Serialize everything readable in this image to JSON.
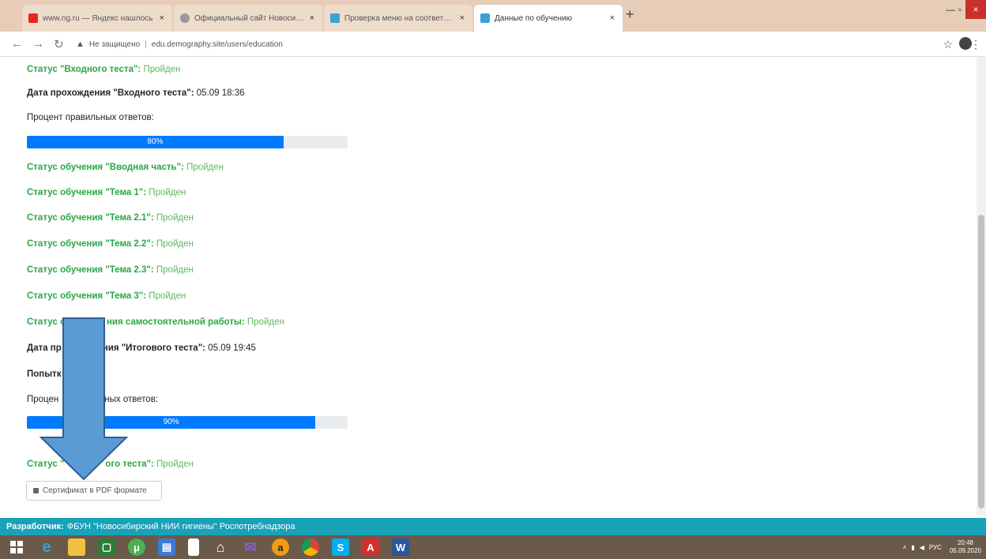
{
  "browser": {
    "tabs": [
      {
        "label": "www.ng.ru — Яндекс нашлось",
        "icon": "yandex-icon",
        "color": "#e52620"
      },
      {
        "label": "Официальный сайт Новосибир",
        "icon": "globe-icon",
        "color": "#777777"
      },
      {
        "label": "Проверка меню на соответств",
        "icon": "edu-icon",
        "color": "#3aa0d8"
      },
      {
        "label": "Данные по обучению",
        "icon": "edu-icon",
        "color": "#3aa0d8"
      }
    ],
    "new_tab": "+",
    "address": {
      "warning": "Не защищено",
      "url": "edu.demography.site/users/education"
    }
  },
  "education": {
    "entry_status": {
      "label": "Статус \"Входного теста\":",
      "value": "Пройден"
    },
    "entry_date": {
      "label": "Дата прохождения \"Входного теста\":",
      "value": "05.09 18:36"
    },
    "entry_percent_label": "Процент правильных ответов:",
    "entry_progress": {
      "text": "80%",
      "value": 0.8
    },
    "topics": [
      {
        "label": "Статус обучения \"Вводная часть\":",
        "value": "Пройден"
      },
      {
        "label": "Статус обучения \"Тема 1\":",
        "value": "Пройден"
      },
      {
        "label": "Статус обучения \"Тема 2.1\":",
        "value": "Пройден"
      },
      {
        "label": "Статус обучения \"Тема 2.2\":",
        "value": "Пройден"
      },
      {
        "label": "Статус обучения \"Тема 2.3\":",
        "value": "Пройден"
      },
      {
        "label": "Статус обучения \"Тема 3\":",
        "value": "Пройден"
      }
    ],
    "independent_work": {
      "label_a": "Статус о",
      "label_b": "ния самостоятельной работы:",
      "value": "Пройден"
    },
    "final_date": {
      "label_a": "Дата пр",
      "label_b": "ния \"Итогового теста\":",
      "value": "05.09 19:45"
    },
    "attempts_label": "Попытк",
    "final_percent_label_a": "Процен",
    "final_percent_label_b": "ьных ответов:",
    "final_progress": {
      "text": "90%",
      "value": 0.9
    },
    "final_status": {
      "label_a": "Статус \"",
      "label_b": "ого теста\":",
      "value": "Пройден"
    },
    "certificate_button": "Сертификат в PDF формате"
  },
  "footer": {
    "label": "Разработчик:",
    "text": "ФБУН \"Новосибирский НИИ гигиены\" Роспотребнадзора"
  },
  "taskbar": {
    "apps": [
      "windows-start-icon",
      "ie-icon",
      "explorer-icon",
      "store-icon",
      "torrent-icon",
      "monitor-icon",
      "file-icon",
      "home-icon",
      "mail-icon",
      "avast-icon",
      "chrome-icon",
      "skype-icon",
      "pdf-icon",
      "word-icon"
    ],
    "tray_lang": "РУС",
    "time": "20:48",
    "date": "05.09.2020"
  },
  "colors": {
    "green": "#28a745",
    "progress": "#007bff",
    "footer": "#17a2b8",
    "arrow": "#5b9bd5"
  }
}
